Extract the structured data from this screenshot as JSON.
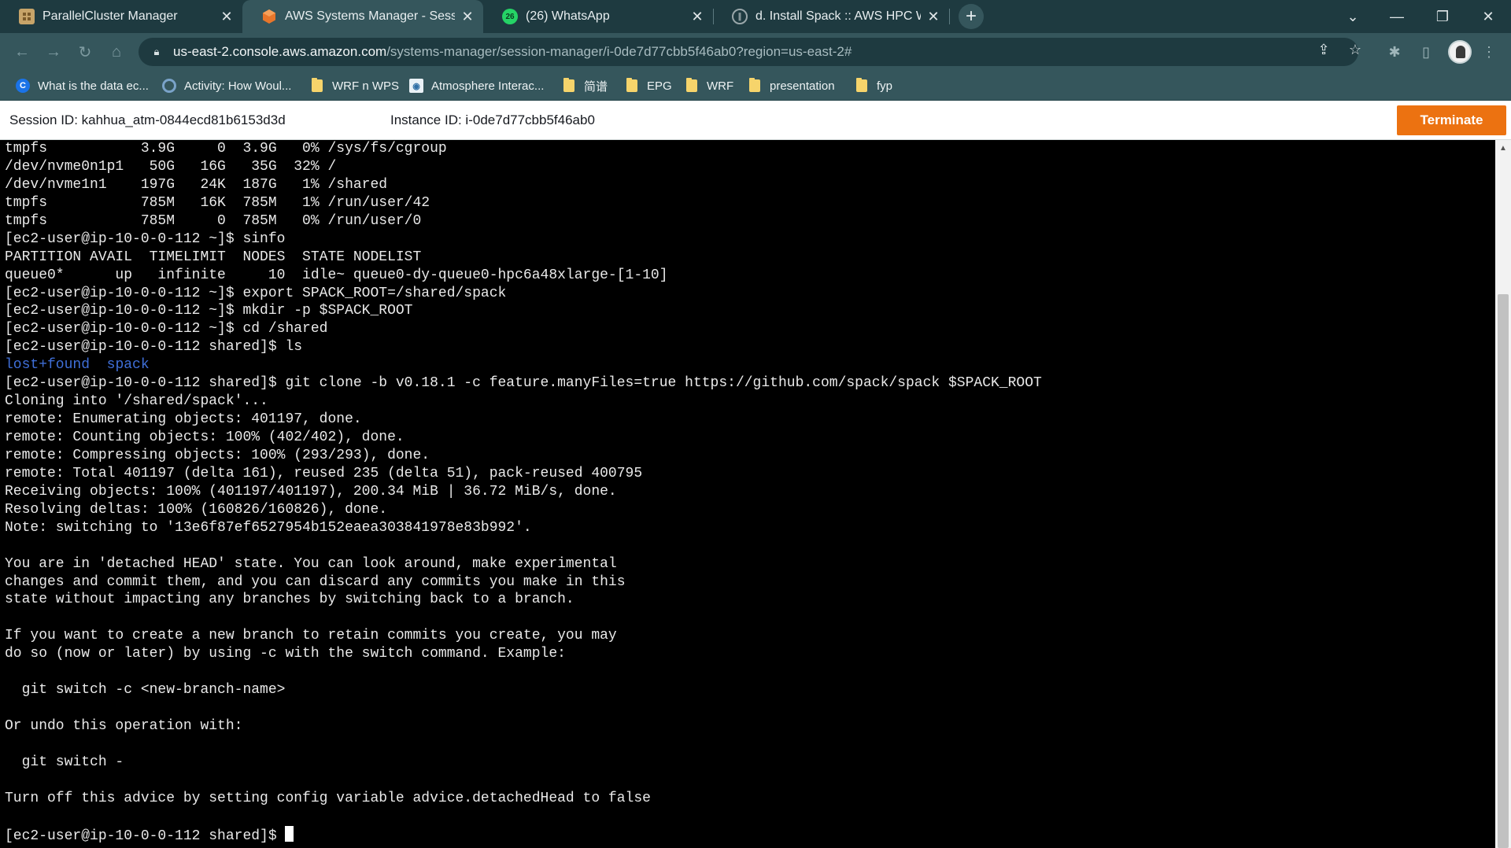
{
  "browser": {
    "tabs": [
      {
        "title": "ParallelCluster Manager",
        "icon": "parallelcluster-icon",
        "active": false
      },
      {
        "title": "AWS Systems Manager - Session",
        "icon": "aws-ssm-icon",
        "active": true
      },
      {
        "title": "(26) WhatsApp",
        "icon": "whatsapp-icon",
        "badge": "26",
        "active": false
      },
      {
        "title": "d. Install Spack :: AWS HPC Work",
        "icon": "aws-workshop-icon",
        "active": false
      }
    ],
    "url_host": "us-east-2.console.aws.amazon.com",
    "url_path": "/systems-manager/session-manager/i-0de7d77cbb5f46ab0?region=us-east-2#",
    "bookmarks": [
      {
        "label": "What is the data ec...",
        "icon": "c-site-icon"
      },
      {
        "label": "Activity: How Woul...",
        "icon": "circle-site-icon"
      },
      {
        "label": "WRF n WPS",
        "icon": "folder-icon"
      },
      {
        "label": "Atmosphere Interac...",
        "icon": "globe-site-icon"
      },
      {
        "label": "简谱",
        "icon": "folder-icon"
      },
      {
        "label": "EPG",
        "icon": "folder-icon"
      },
      {
        "label": "WRF",
        "icon": "folder-icon"
      },
      {
        "label": "presentation",
        "icon": "folder-icon"
      },
      {
        "label": "fyp",
        "icon": "folder-icon"
      }
    ]
  },
  "session": {
    "session_id": "Session ID: kahhua_atm-0844ecd81b6153d3d",
    "instance_id": "Instance ID: i-0de7d77cbb5f46ab0",
    "terminate_label": "Terminate"
  },
  "terminal": {
    "lines": [
      "tmpfs           3.9G     0  3.9G   0% /sys/fs/cgroup",
      "/dev/nvme0n1p1   50G   16G   35G  32% /",
      "/dev/nvme1n1    197G   24K  187G   1% /shared",
      "tmpfs           785M   16K  785M   1% /run/user/42",
      "tmpfs           785M     0  785M   0% /run/user/0",
      "[ec2-user@ip-10-0-0-112 ~]$ sinfo",
      "PARTITION AVAIL  TIMELIMIT  NODES  STATE NODELIST",
      "queue0*      up   infinite     10  idle~ queue0-dy-queue0-hpc6a48xlarge-[1-10]",
      "[ec2-user@ip-10-0-0-112 ~]$ export SPACK_ROOT=/shared/spack",
      "[ec2-user@ip-10-0-0-112 ~]$ mkdir -p $SPACK_ROOT",
      "[ec2-user@ip-10-0-0-112 ~]$ cd /shared",
      "[ec2-user@ip-10-0-0-112 shared]$ ls",
      "lost+found  spack",
      "[ec2-user@ip-10-0-0-112 shared]$ git clone -b v0.18.1 -c feature.manyFiles=true https://github.com/spack/spack $SPACK_ROOT",
      "Cloning into '/shared/spack'...",
      "remote: Enumerating objects: 401197, done.",
      "remote: Counting objects: 100% (402/402), done.",
      "remote: Compressing objects: 100% (293/293), done.",
      "remote: Total 401197 (delta 161), reused 235 (delta 51), pack-reused 400795",
      "Receiving objects: 100% (401197/401197), 200.34 MiB | 36.72 MiB/s, done.",
      "Resolving deltas: 100% (160826/160826), done.",
      "Note: switching to '13e6f87ef6527954b152eaea303841978e83b992'.",
      "",
      "You are in 'detached HEAD' state. You can look around, make experimental",
      "changes and commit them, and you can discard any commits you make in this",
      "state without impacting any branches by switching back to a branch.",
      "",
      "If you want to create a new branch to retain commits you create, you may",
      "do so (now or later) by using -c with the switch command. Example:",
      "",
      "  git switch -c <new-branch-name>",
      "",
      "Or undo this operation with:",
      "",
      "  git switch -",
      "",
      "Turn off this advice by setting config variable advice.detachedHead to false",
      "",
      "[ec2-user@ip-10-0-0-112 shared]$ "
    ],
    "ls_dir_color": "#3f6fd8"
  }
}
